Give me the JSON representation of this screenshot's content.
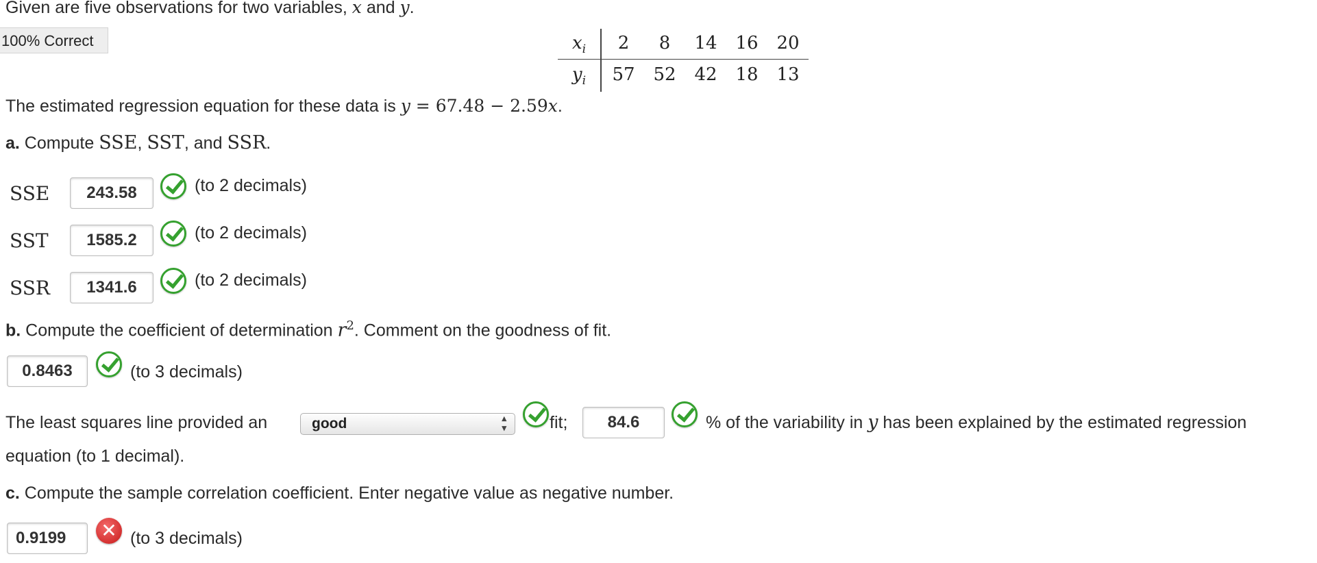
{
  "intro": {
    "before": "Given are five observations for two variables, ",
    "var1": "x",
    "mid": " and ",
    "var2": "y",
    "end": "."
  },
  "badge": "100% Correct",
  "table": {
    "x_label": "xi",
    "y_label": "yi",
    "x_values": [
      "2",
      "8",
      "14",
      "16",
      "20"
    ],
    "y_values": [
      "57",
      "52",
      "42",
      "18",
      "13"
    ]
  },
  "equation_text": {
    "before": "The estimated regression equation for these data is ",
    "lhs": "y",
    "rhs": " = 67.48 − 2.59",
    "var": "x",
    "end": "."
  },
  "part_a": {
    "label": "a.",
    "prompt_before": " Compute ",
    "t1": "SSE",
    "sep1": ", ",
    "t2": "SST",
    "sep2": ", and ",
    "t3": "SSR",
    "end": ".",
    "rows": [
      {
        "label": "SSE",
        "value": "243.58",
        "note": "(to 2 decimals)"
      },
      {
        "label": "SST",
        "value": "1585.2",
        "note": "(to 2 decimals)"
      },
      {
        "label": "SSR",
        "value": "1341.6",
        "note": "(to 2 decimals)"
      }
    ]
  },
  "part_b": {
    "label": "b.",
    "prompt_before": " Compute the coefficient of determination ",
    "r": "r",
    "exp": "2",
    "prompt_after": ". Comment on the goodness of fit.",
    "r2_value": "0.8463",
    "r2_note": "(to 3 decimals)",
    "sentence_start": "The least squares line provided an",
    "fit_selected": "good",
    "fit_word": "fit;",
    "percent_value": "84.6",
    "after_percent": "% of the variability in ",
    "var": "y",
    "after_var": " has been explained by the estimated regression",
    "line2": "equation (to 1 decimal)."
  },
  "part_c": {
    "label": "c.",
    "prompt": " Compute the sample correlation coefficient. Enter negative value as negative number.",
    "value": "0.9199",
    "note": "(to 3 decimals)"
  },
  "status_colors": {
    "correct": "#35a12f",
    "incorrect": "#c71818"
  },
  "icons": {
    "correct": "check-circle-icon",
    "incorrect": "x-circle-icon"
  }
}
